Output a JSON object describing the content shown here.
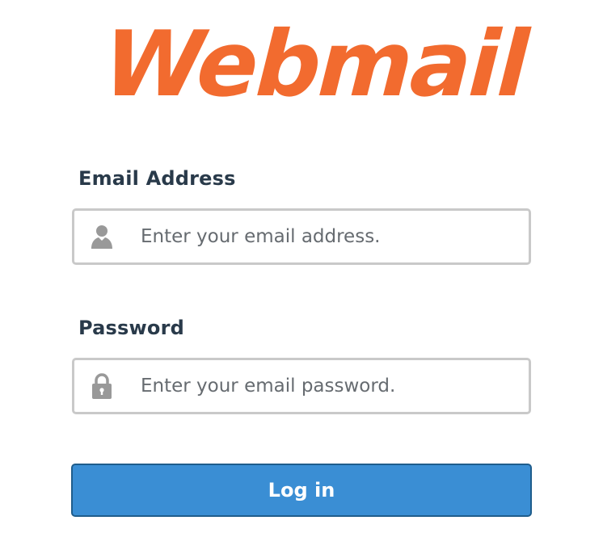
{
  "brand": {
    "logo_text": "Webmail",
    "logo_color": "#f26b2f"
  },
  "login_form": {
    "email": {
      "label": "Email Address",
      "placeholder": "Enter your email address.",
      "value": "",
      "icon": "user-icon"
    },
    "password": {
      "label": "Password",
      "placeholder": "Enter your email password.",
      "value": "",
      "icon": "lock-icon"
    },
    "submit_label": "Log in",
    "button_color": "#3a8ed4"
  }
}
